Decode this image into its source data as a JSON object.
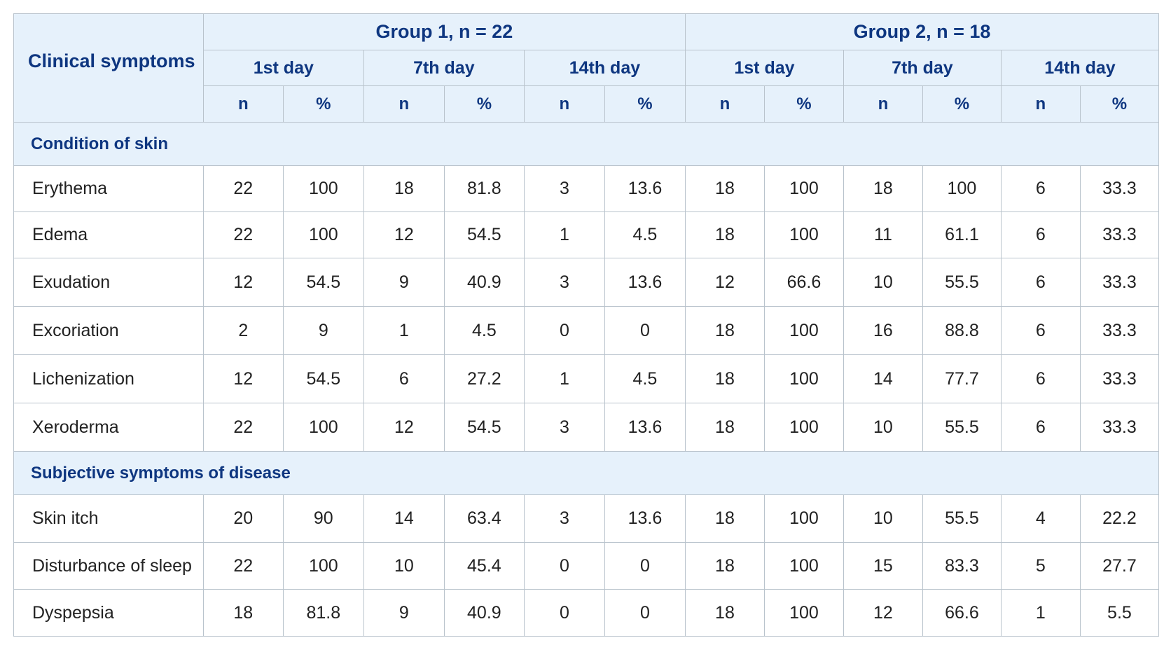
{
  "table": {
    "corner_label": "Clinical symptoms",
    "groups": [
      "Group 1, n = 22",
      "Group 2, n = 18"
    ],
    "days": [
      "1st day",
      "7th day",
      "14th day"
    ],
    "subcols": [
      "n",
      "%"
    ],
    "sections": [
      {
        "title": "Condition of skin",
        "rows": [
          {
            "label": "Erythema",
            "values": [
              "22",
              "100",
              "18",
              "81.8",
              "3",
              "13.6",
              "18",
              "100",
              "18",
              "100",
              "6",
              "33.3"
            ]
          },
          {
            "label": "Edema",
            "values": [
              "22",
              "100",
              "12",
              "54.5",
              "1",
              "4.5",
              "18",
              "100",
              "11",
              "61.1",
              "6",
              "33.3"
            ]
          },
          {
            "label": "Exudation",
            "values": [
              "12",
              "54.5",
              "9",
              "40.9",
              "3",
              "13.6",
              "12",
              "66.6",
              "10",
              "55.5",
              "6",
              "33.3"
            ]
          },
          {
            "label": "Excoriation",
            "values": [
              "2",
              "9",
              "1",
              "4.5",
              "0",
              "0",
              "18",
              "100",
              "16",
              "88.8",
              "6",
              "33.3"
            ]
          },
          {
            "label": "Lichenization",
            "values": [
              "12",
              "54.5",
              "6",
              "27.2",
              "1",
              "4.5",
              "18",
              "100",
              "14",
              "77.7",
              "6",
              "33.3"
            ]
          },
          {
            "label": "Xeroderma",
            "values": [
              "22",
              "100",
              "12",
              "54.5",
              "3",
              "13.6",
              "18",
              "100",
              "10",
              "55.5",
              "6",
              "33.3"
            ]
          }
        ]
      },
      {
        "title": "Subjective symptoms of disease",
        "rows": [
          {
            "label": "Skin itch",
            "values": [
              "20",
              "90",
              "14",
              "63.4",
              "3",
              "13.6",
              "18",
              "100",
              "10",
              "55.5",
              "4",
              "22.2"
            ]
          },
          {
            "label": "Disturbance of sleep",
            "values": [
              "22",
              "100",
              "10",
              "45.4",
              "0",
              "0",
              "18",
              "100",
              "15",
              "83.3",
              "5",
              "27.7"
            ]
          },
          {
            "label": "Dyspepsia",
            "values": [
              "18",
              "81.8",
              "9",
              "40.9",
              "0",
              "0",
              "18",
              "100",
              "12",
              "66.6",
              "1",
              "5.5"
            ]
          }
        ]
      }
    ]
  }
}
